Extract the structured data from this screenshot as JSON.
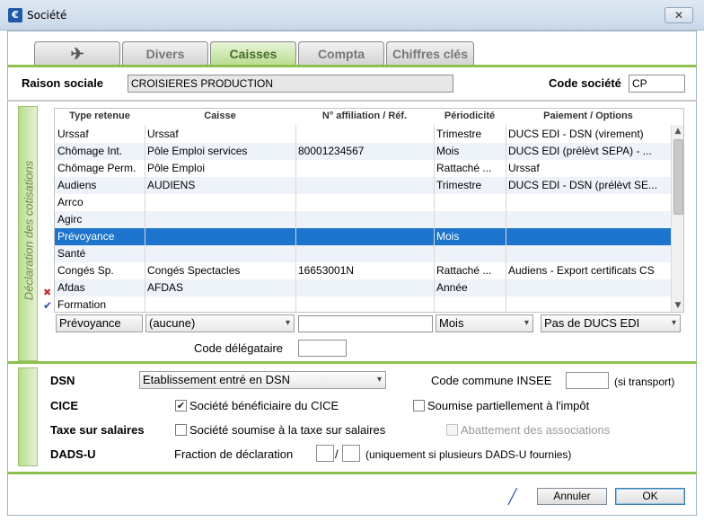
{
  "window": {
    "title": "Société",
    "close_glyph": "✕",
    "app_icon": "€"
  },
  "tabs": [
    {
      "label": "",
      "icon": "plane-icon"
    },
    {
      "label": "Divers"
    },
    {
      "label": "Caisses",
      "active": true
    },
    {
      "label": "Compta"
    },
    {
      "label": "Chiffres clés"
    }
  ],
  "header": {
    "raison_label": "Raison sociale",
    "raison_value": "CROISIERES PRODUCTION",
    "code_label": "Code société",
    "code_value": "CP"
  },
  "cotisations": {
    "side_title": "Déclaration des cotisations",
    "columns": [
      "Type retenue",
      "Caisse",
      "N° affiliation / Réf.",
      "Périodicité",
      "Paiement / Options"
    ],
    "rows": [
      {
        "type": "Urssaf",
        "caisse": "Urssaf",
        "affiliation": "",
        "periodicite": "Trimestre",
        "paiement": "DUCS EDI - DSN (virement)"
      },
      {
        "type": "Chômage Int.",
        "caisse": "Pôle Emploi services",
        "affiliation": "80001234567",
        "periodicite": "Mois",
        "paiement": "DUCS EDI (prélèvt SEPA) - ..."
      },
      {
        "type": "Chômage Perm.",
        "caisse": "Pôle Emploi",
        "affiliation": "",
        "periodicite": "Rattaché ...",
        "paiement": "Urssaf"
      },
      {
        "type": "Audiens",
        "caisse": "AUDIENS",
        "affiliation": "",
        "periodicite": "Trimestre",
        "paiement": "DUCS EDI - DSN (prélèvt SE..."
      },
      {
        "type": "Arrco",
        "caisse": "",
        "affiliation": "",
        "periodicite": "",
        "paiement": ""
      },
      {
        "type": "Agirc",
        "caisse": "",
        "affiliation": "",
        "periodicite": "",
        "paiement": ""
      },
      {
        "type": "Prévoyance",
        "caisse": "",
        "affiliation": "",
        "periodicite": "Mois",
        "paiement": "",
        "selected": true
      },
      {
        "type": "Santé",
        "caisse": "",
        "affiliation": "",
        "periodicite": "",
        "paiement": ""
      },
      {
        "type": "Congés Sp.",
        "caisse": "Congés Spectacles",
        "affiliation": "16653001N",
        "periodicite": "Rattaché ...",
        "paiement": "Audiens - Export certificats CS"
      },
      {
        "type": "Afdas",
        "caisse": "AFDAS",
        "affiliation": "",
        "periodicite": "Année",
        "paiement": ""
      },
      {
        "type": "Formation",
        "caisse": "",
        "affiliation": "",
        "periodicite": "",
        "paiement": ""
      }
    ],
    "editor": {
      "type_label": "Prévoyance",
      "caisse_value": "(aucune)",
      "affiliation_value": "",
      "periodicite_value": "Mois",
      "paiement_value": "Pas de DUCS EDI",
      "delegataire_label": "Code délégataire",
      "delegataire_value": ""
    },
    "marks": {
      "x": "✖",
      "v": "✔"
    }
  },
  "options": {
    "dsn_label": "DSN",
    "dsn_value": "Etablissement entré en DSN",
    "insee_label": "Code commune INSEE",
    "insee_value": "",
    "insee_note": "(si transport)",
    "cice_label": "CICE",
    "cice_check_label": "Société bénéficiaire du CICE",
    "cice_checked": true,
    "partiel_label": "Soumise partiellement à l'impôt",
    "partiel_checked": false,
    "taxe_label": "Taxe sur salaires",
    "taxe_check_label": "Société soumise à la taxe sur salaires",
    "taxe_checked": false,
    "abattement_label": "Abattement des associations",
    "abattement_checked": false,
    "dads_label": "DADS-U",
    "fraction_label": "Fraction de déclaration",
    "fraction_num": "",
    "fraction_sep": "/",
    "fraction_den": "",
    "fraction_note": "(uniquement si plusieurs DADS-U fournies)"
  },
  "footer": {
    "annuler_label": "Annuler",
    "ok_label": "OK"
  },
  "colors": {
    "accent_green": "#8cc14f",
    "selection_blue": "#1c74cc"
  }
}
